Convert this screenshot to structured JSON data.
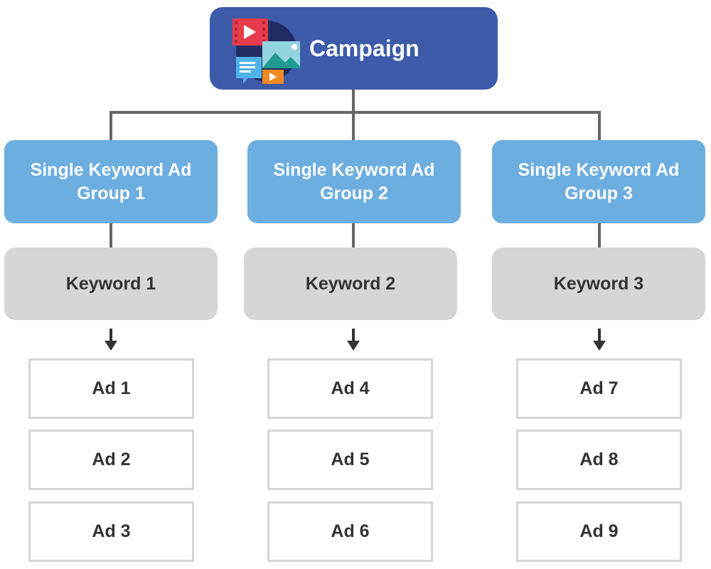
{
  "campaign": {
    "label": "Campaign",
    "icon": "media-campaign-icon",
    "color": "#3d5ba9"
  },
  "colors": {
    "ad_group": "#6caee0",
    "keyword": "#d6d6d6",
    "ad_border": "#d6d6d6",
    "connector": "#666666"
  },
  "columns": [
    {
      "group": "Single Keyword Ad Group 1",
      "keyword": "Keyword 1",
      "ads": [
        "Ad 1",
        "Ad 2",
        "Ad 3"
      ]
    },
    {
      "group": "Single Keyword Ad Group 2",
      "keyword": "Keyword 2",
      "ads": [
        "Ad 4",
        "Ad 5",
        "Ad 6"
      ]
    },
    {
      "group": "Single Keyword Ad Group 3",
      "keyword": "Keyword 3",
      "ads": [
        "Ad 7",
        "Ad 8",
        "Ad 9"
      ]
    }
  ]
}
